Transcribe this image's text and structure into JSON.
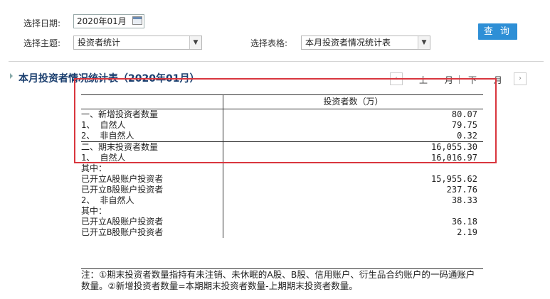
{
  "filters": {
    "date_label": "选择日期:",
    "date_value": "2020年01月",
    "topic_label": "选择主题:",
    "topic_value": "投资者统计",
    "table_label": "选择表格:",
    "table_value": "本月投资者情况统计表",
    "query_button": "查 询"
  },
  "section": {
    "title": "本月投资者情况统计表（2020年01月）",
    "prev_label": "上 月",
    "next_label": "下 月",
    "separator": "|"
  },
  "table": {
    "column_header": "投资者数（万）",
    "rows": [
      {
        "label": "一、新增投资者数量",
        "value": "80.07"
      },
      {
        "label": "1、 自然人",
        "value": "79.75"
      },
      {
        "label": "2、 非自然人",
        "value": "0.32"
      },
      {
        "label": "二、期末投资者数量",
        "value": "16,055.30"
      },
      {
        "label": "1、 自然人",
        "value": "16,016.97"
      },
      {
        "label": "其中：",
        "value": ""
      },
      {
        "label": "已开立A股账户投资者",
        "value": "15,955.62"
      },
      {
        "label": "已开立B股账户投资者",
        "value": "237.76"
      },
      {
        "label": "2、 非自然人",
        "value": "38.33"
      },
      {
        "label": "其中：",
        "value": ""
      },
      {
        "label": "已开立A股账户投资者",
        "value": "36.18"
      },
      {
        "label": "已开立B股账户投资者",
        "value": "2.19"
      }
    ],
    "note": "注：①期末投资者数量指持有未注销、未休眠的A股、B股、信用账户、衍生品合约账户的一码通账户数量。②新增投资者数量=本期期末投资者数量-上期期末投资者数量。"
  },
  "colors": {
    "accent": "#2e8fd6",
    "title": "#1a3e6e",
    "highlight": "#d9363e"
  },
  "icons": {
    "calendar": "calendar-icon",
    "dropdown": "chevron-down-icon",
    "nav_prev": "chevron-left-icon",
    "nav_next": "chevron-right-icon"
  }
}
